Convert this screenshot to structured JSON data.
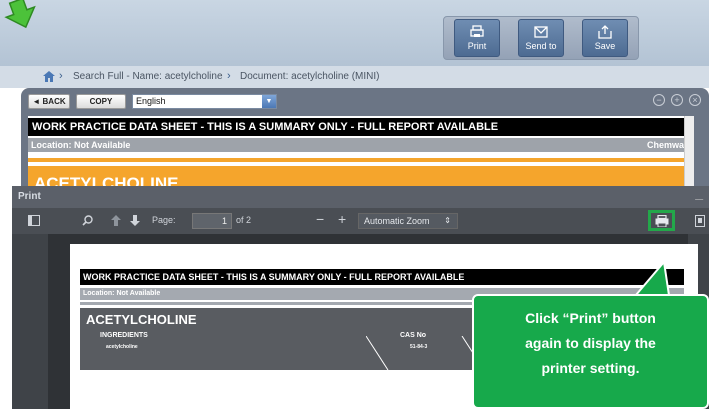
{
  "toolbar": {
    "print_label": "Print",
    "sendto_label": "Send to",
    "save_label": "Save"
  },
  "breadcrumb": {
    "item1": "Search Full - Name: acetylcholine",
    "item2": "Document: acetylcholine (MINI)"
  },
  "docbar": {
    "back_label": "◄ BACK",
    "copy_label": "COPY",
    "language_value": "English"
  },
  "document": {
    "header": "WORK PRACTICE DATA SHEET - THIS IS A SUMMARY ONLY - FULL REPORT AVAILABLE",
    "location": "Location: Not Available",
    "location_right": "Chemwa",
    "chemical_name": "ACETYLCHOLINE"
  },
  "print_dialog": {
    "title": "Print",
    "page_label": "Page:",
    "page_value": "1",
    "page_total": "of 2",
    "zoom_value": "Automatic Zoom"
  },
  "preview": {
    "header": "WORK PRACTICE DATA SHEET - THIS IS A SUMMARY ONLY - FULL REPORT AVAILABLE",
    "location": "Location: Not Available",
    "chemical_name": "ACETYLCHOLINE",
    "col_ingredients": "INGREDIENTS",
    "col_cas": "CAS No",
    "row_name": "acetylcholine",
    "row_cas": "51-84-3"
  },
  "callout": {
    "line1": "Click “Print” button",
    "line2": "again to display the",
    "line3": "printer setting."
  },
  "colors": {
    "accent_green": "#17a94b",
    "orange": "#f5a52c"
  }
}
